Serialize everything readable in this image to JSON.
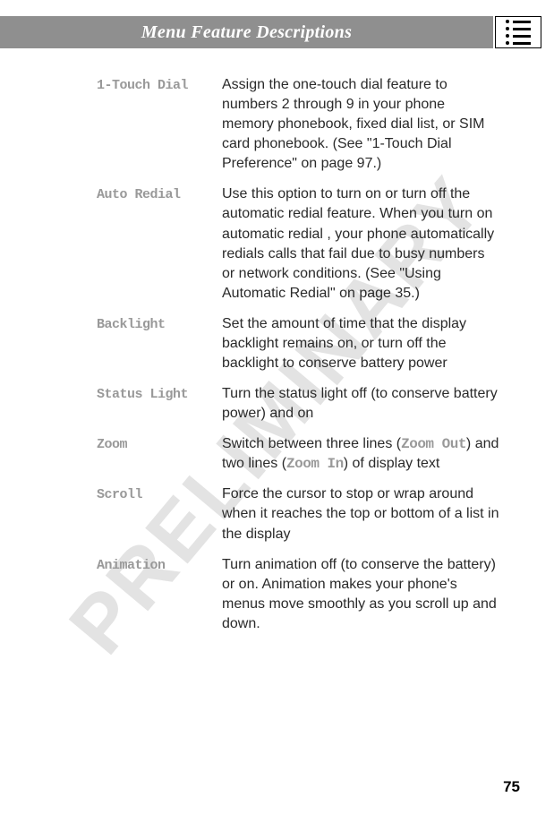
{
  "watermark": "PRELIMINARY",
  "header": {
    "title": "Menu Feature Descriptions"
  },
  "items": [
    {
      "term": "1-Touch Dial",
      "desc": "Assign the one-touch dial feature to numbers 2 through 9 in your phone memory phonebook, fixed dial list, or SIM card phonebook. (See \"1-Touch Dial Preference\" on page 97.)"
    },
    {
      "term": "Auto Redial",
      "desc": "Use this option to turn on or turn off the automatic redial feature. When you turn on automatic redial , your phone automatically redials calls that fail due to busy numbers or network conditions. (See \"Using Automatic Redial\" on page 35.)"
    },
    {
      "term": "Backlight",
      "desc": "Set the amount of time that the display backlight remains on, or turn off the backlight to conserve battery power"
    },
    {
      "term": "Status Light",
      "desc": "Turn the status light off (to conserve battery power) and on"
    },
    {
      "term": "Zoom",
      "desc_parts": [
        "Switch between three lines (",
        "Zoom Out",
        ") and two lines (",
        "Zoom In",
        ") of display text"
      ]
    },
    {
      "term": "Scroll",
      "desc": "Force the cursor to stop or wrap around when it reaches the top or bottom of a list in the display"
    },
    {
      "term": "Animation",
      "desc": "Turn animation off (to conserve the battery) or on. Animation makes your phone's menus move smoothly as you scroll up and down."
    }
  ],
  "page_number": "75"
}
